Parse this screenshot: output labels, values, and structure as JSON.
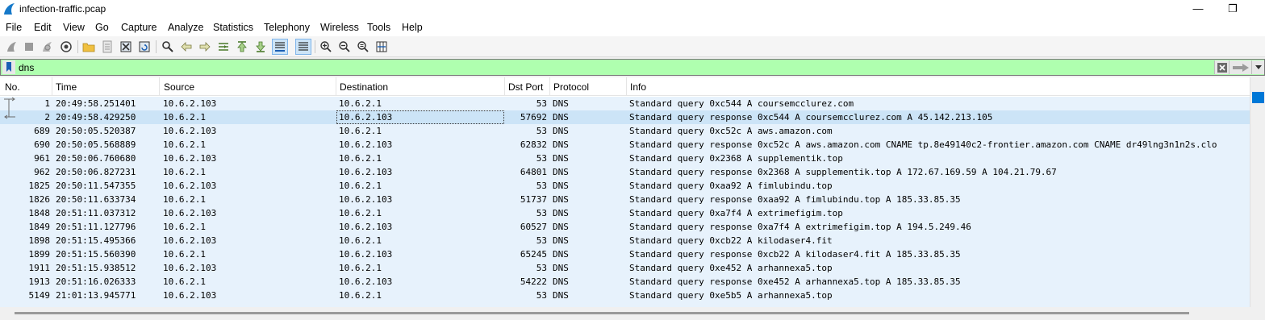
{
  "window": {
    "title": "infection-traffic.pcap",
    "minimize_glyph": "—",
    "restore_glyph": "❐"
  },
  "menu": [
    "File",
    "Edit",
    "View",
    "Go",
    "Capture",
    "Analyze",
    "Statistics",
    "Telephony",
    "Wireless",
    "Tools",
    "Help"
  ],
  "toolbar_icons": [
    "start-capture-icon",
    "stop-capture-icon",
    "restart-capture-icon",
    "capture-options-icon",
    "open-file-icon",
    "save-file-icon",
    "close-file-icon",
    "reload-file-icon",
    "find-packet-icon",
    "go-back-icon",
    "go-forward-icon",
    "go-to-packet-icon",
    "go-first-icon",
    "go-last-icon",
    "auto-scroll-icon",
    "colorize-icon",
    "zoom-in-icon",
    "zoom-out-icon",
    "zoom-normal-icon",
    "resize-columns-icon"
  ],
  "filter": {
    "value": "dns",
    "bg_color": "#afffaf"
  },
  "columns": [
    "No.",
    "Time",
    "Source",
    "Destination",
    "Dst Port",
    "Protocol",
    "Info"
  ],
  "rows": [
    {
      "no": "1",
      "time": "20:49:58.251401",
      "src": "10.6.2.103",
      "dst": "10.6.2.1",
      "port": "53",
      "proto": "DNS",
      "info": "Standard query 0xc544 A coursemcclurez.com"
    },
    {
      "no": "2",
      "time": "20:49:58.429250",
      "src": "10.6.2.1",
      "dst": "10.6.2.103",
      "port": "57692",
      "proto": "DNS",
      "info": "Standard query response 0xc544 A coursemcclurez.com A 45.142.213.105"
    },
    {
      "no": "689",
      "time": "20:50:05.520387",
      "src": "10.6.2.103",
      "dst": "10.6.2.1",
      "port": "53",
      "proto": "DNS",
      "info": "Standard query 0xc52c A aws.amazon.com"
    },
    {
      "no": "690",
      "time": "20:50:05.568889",
      "src": "10.6.2.1",
      "dst": "10.6.2.103",
      "port": "62832",
      "proto": "DNS",
      "info": "Standard query response 0xc52c A aws.amazon.com CNAME tp.8e49140c2-frontier.amazon.com CNAME dr49lng3n1n2s.clo"
    },
    {
      "no": "961",
      "time": "20:50:06.760680",
      "src": "10.6.2.103",
      "dst": "10.6.2.1",
      "port": "53",
      "proto": "DNS",
      "info": "Standard query 0x2368 A supplementik.top"
    },
    {
      "no": "962",
      "time": "20:50:06.827231",
      "src": "10.6.2.1",
      "dst": "10.6.2.103",
      "port": "64801",
      "proto": "DNS",
      "info": "Standard query response 0x2368 A supplementik.top A 172.67.169.59 A 104.21.79.67"
    },
    {
      "no": "1825",
      "time": "20:50:11.547355",
      "src": "10.6.2.103",
      "dst": "10.6.2.1",
      "port": "53",
      "proto": "DNS",
      "info": "Standard query 0xaa92 A fimlubindu.top"
    },
    {
      "no": "1826",
      "time": "20:50:11.633734",
      "src": "10.6.2.1",
      "dst": "10.6.2.103",
      "port": "51737",
      "proto": "DNS",
      "info": "Standard query response 0xaa92 A fimlubindu.top A 185.33.85.35"
    },
    {
      "no": "1848",
      "time": "20:51:11.037312",
      "src": "10.6.2.103",
      "dst": "10.6.2.1",
      "port": "53",
      "proto": "DNS",
      "info": "Standard query 0xa7f4 A extrimefigim.top"
    },
    {
      "no": "1849",
      "time": "20:51:11.127796",
      "src": "10.6.2.1",
      "dst": "10.6.2.103",
      "port": "60527",
      "proto": "DNS",
      "info": "Standard query response 0xa7f4 A extrimefigim.top A 194.5.249.46"
    },
    {
      "no": "1898",
      "time": "20:51:15.495366",
      "src": "10.6.2.103",
      "dst": "10.6.2.1",
      "port": "53",
      "proto": "DNS",
      "info": "Standard query 0xcb22 A kilodaser4.fit"
    },
    {
      "no": "1899",
      "time": "20:51:15.560390",
      "src": "10.6.2.1",
      "dst": "10.6.2.103",
      "port": "65245",
      "proto": "DNS",
      "info": "Standard query response 0xcb22 A kilodaser4.fit A 185.33.85.35"
    },
    {
      "no": "1911",
      "time": "20:51:15.938512",
      "src": "10.6.2.103",
      "dst": "10.6.2.1",
      "port": "53",
      "proto": "DNS",
      "info": "Standard query 0xe452 A arhannexa5.top"
    },
    {
      "no": "1913",
      "time": "20:51:16.026333",
      "src": "10.6.2.1",
      "dst": "10.6.2.103",
      "port": "54222",
      "proto": "DNS",
      "info": "Standard query response 0xe452 A arhannexa5.top A 185.33.85.35"
    },
    {
      "no": "5149",
      "time": "21:01:13.945771",
      "src": "10.6.2.103",
      "dst": "10.6.2.1",
      "port": "53",
      "proto": "DNS",
      "info": "Standard query 0xe5b5 A arhannexa5.top"
    }
  ],
  "selected_row_index": 1,
  "row_color": "#e7f2fc",
  "selected_color": "#cce4f7"
}
